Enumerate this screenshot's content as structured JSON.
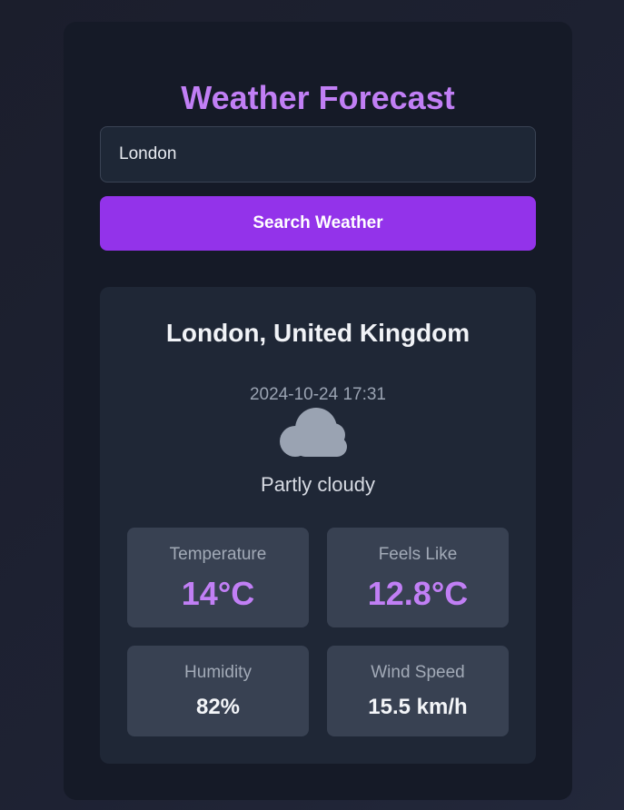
{
  "app": {
    "title": "Weather Forecast"
  },
  "search": {
    "value": "London",
    "button_label": "Search Weather"
  },
  "weather": {
    "location": "London, United Kingdom",
    "local_time": "2024-10-24 17:31",
    "condition": "Partly cloudy",
    "icon": "cloud-icon",
    "stats": {
      "temperature": {
        "label": "Temperature",
        "value": "14°C"
      },
      "feels_like": {
        "label": "Feels Like",
        "value": "12.8°C"
      },
      "humidity": {
        "label": "Humidity",
        "value": "82%"
      },
      "wind_speed": {
        "label": "Wind Speed",
        "value": "15.5 km/h"
      }
    }
  },
  "colors": {
    "accent": "#c17ff5",
    "button": "#9333ea",
    "card_background": "#151a27",
    "panel_background": "#1f2736",
    "stat_background": "#384152"
  }
}
